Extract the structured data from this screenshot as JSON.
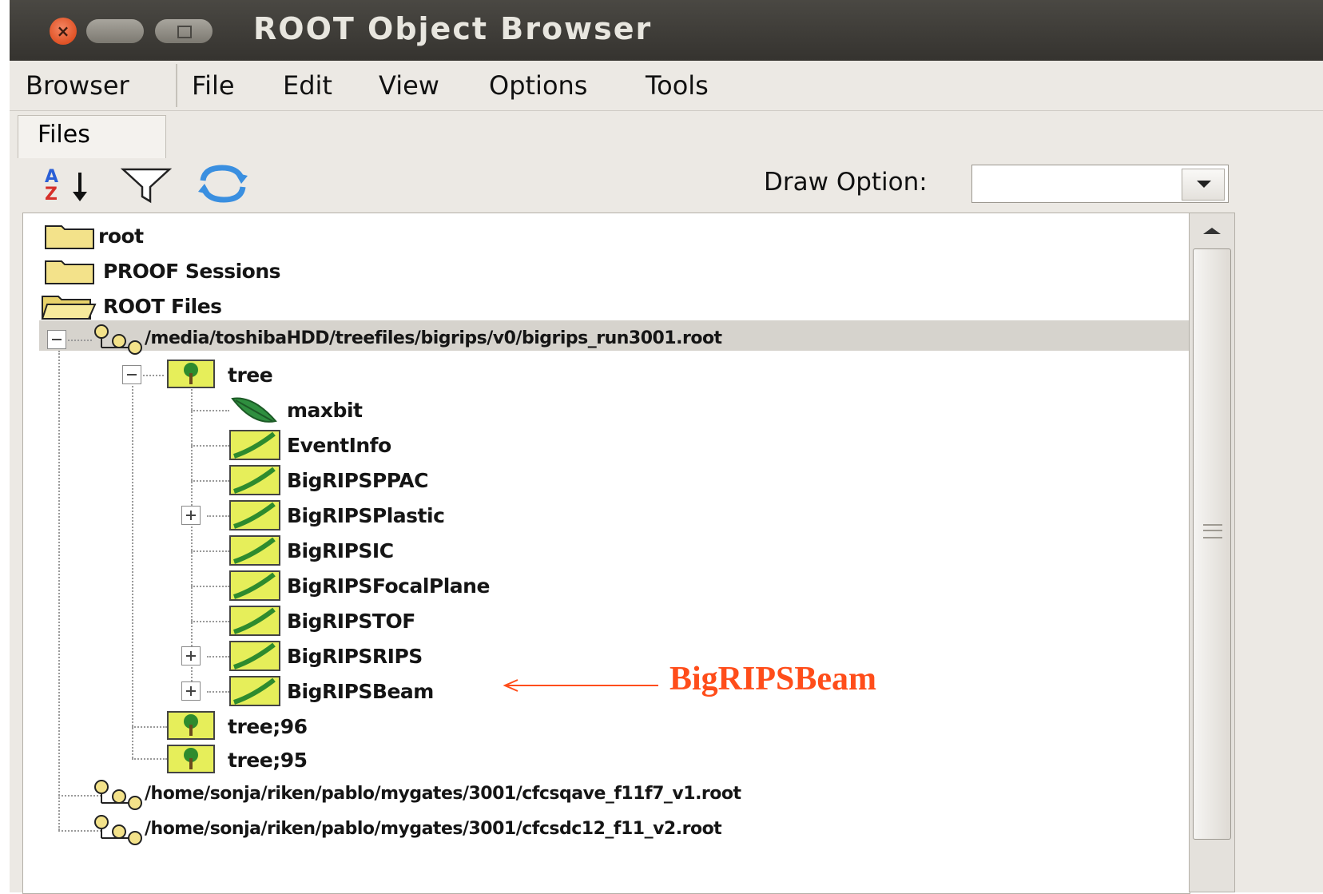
{
  "window": {
    "title": "ROOT Object Browser"
  },
  "menubar": {
    "items": [
      "Browser",
      "File",
      "Edit",
      "View",
      "Options",
      "Tools"
    ]
  },
  "tabs": [
    {
      "label": "Files"
    }
  ],
  "toolbar": {
    "icons": [
      "sort-icon",
      "filter-icon",
      "refresh-icon"
    ],
    "draw_option_label": "Draw Option:",
    "draw_option_value": ""
  },
  "tree": {
    "top_nodes": [
      "root",
      "PROOF Sessions",
      "ROOT Files"
    ],
    "file1": "/media/toshibaHDD/treefiles/bigrips/v0/bigrips_run3001.root",
    "tree_name": "tree",
    "leaves": [
      "maxbit",
      "EventInfo",
      "BigRIPSPPAC",
      "BigRIPSPlastic",
      "BigRIPSIC",
      "BigRIPSFocalPlane",
      "BigRIPSTOF",
      "BigRIPSRIPS",
      "BigRIPSBeam"
    ],
    "trees_extra": [
      "tree;96",
      "tree;95"
    ],
    "file2": "/home/sonja/riken/pablo/mygates/3001/cfcsqave_f11f7_v1.root",
    "file3": "/home/sonja/riken/pablo/mygates/3001/cfcsdc12_f11_v2.root"
  },
  "annotation": {
    "text": "BigRIPSBeam"
  },
  "colors": {
    "annotation": "#ff4d1a",
    "titlebar": "#3c3a36",
    "close": "#e05225"
  }
}
